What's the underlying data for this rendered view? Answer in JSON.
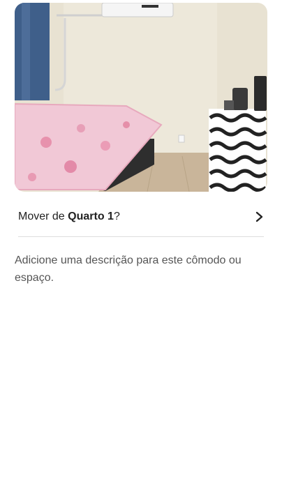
{
  "photo": {
    "icon": "room-photo"
  },
  "move": {
    "prefix": "Mover de ",
    "room_name": "Quarto 1",
    "suffix": "?",
    "icon": "chevron-right-icon"
  },
  "description": {
    "placeholder": "Adicione uma descrição para este cômodo ou espaço."
  }
}
